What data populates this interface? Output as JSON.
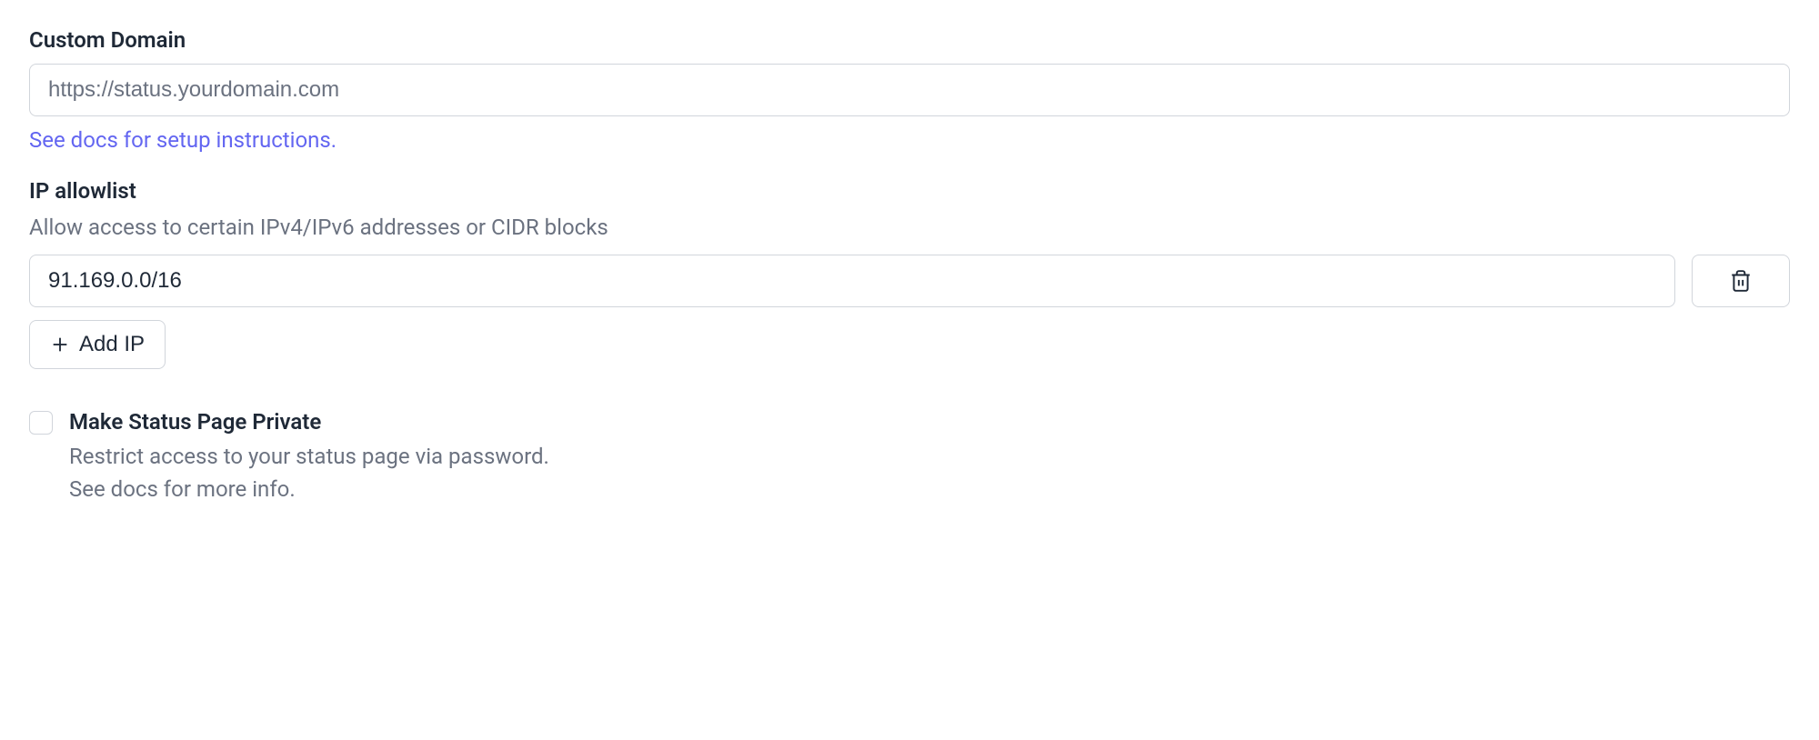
{
  "customDomain": {
    "label": "Custom Domain",
    "placeholder": "https://status.yourdomain.com",
    "value": "",
    "docsLink": "See docs for setup instructions."
  },
  "ipAllowlist": {
    "label": "IP allowlist",
    "sublabel": "Allow access to certain IPv4/IPv6 addresses or CIDR blocks",
    "entries": [
      "91.169.0.0/16"
    ],
    "addButtonLabel": "Add IP"
  },
  "privateStatus": {
    "checked": false,
    "title": "Make Status Page Private",
    "descLine1": "Restrict access to your status page via password.",
    "descLine2": "See docs for more info."
  }
}
